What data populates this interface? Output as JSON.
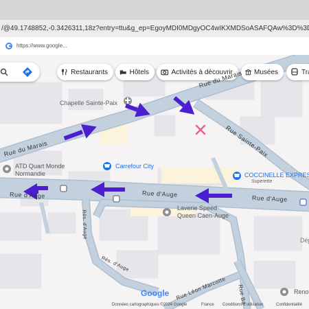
{
  "browser": {
    "url": "/@49.1748852,-0.3426311,18z?entry=ttu&g_ep=EgoyMDI0MDgyOC4wIKXMDSoASAFQAw%3D%3D",
    "suggestion": "https://www.google..."
  },
  "chips": [
    {
      "label": "Restaurants",
      "icon": "fork-knife-icon"
    },
    {
      "label": "Hôtels",
      "icon": "bed-icon"
    },
    {
      "label": "Activités à découvrir",
      "icon": "camera-icon"
    },
    {
      "label": "Musées",
      "icon": "museum-icon"
    },
    {
      "label": "Tra",
      "icon": "transit-icon"
    }
  ],
  "places": {
    "chapelle": "Chapelle Sainte-Paix",
    "atd_line1": "ATD Quart Monde",
    "atd_line2": "Normandie",
    "carrefour": "Carrefour City",
    "coccinelle": "COCCINELLE EXPRESS",
    "coccinelle_sub": "Superette",
    "laverie_line1": "Laverie Speed",
    "laverie_line2": "Queen Caen-Auge",
    "dep": "Dép",
    "reno": "Reno"
  },
  "streets": {
    "marais_top": "Rue du Marais",
    "marais_left": "Rue du Marais",
    "sainte_paix": "Rue Sainte-Paix",
    "auge_left": "Rue d'Auge",
    "auge_center": "Rue d'Auge",
    "auge_right": "Rue d'Auge",
    "rue_d_auge_vertical": "Rés. d'Auge",
    "res_auge_diag": "Rés. d'Auge",
    "leon_marcotte": "Rue Léon Marcotte",
    "rue_ba": "Rue Ba"
  },
  "footer": {
    "logo": "Google",
    "copyright": "Données cartographiques ©2024 Google",
    "country": "France",
    "terms": "Conditions d'utilisation",
    "privacy": "Confidentialité"
  },
  "colors": {
    "road": "#c1cfdd",
    "road_border": "#aebfd0",
    "building": "#e8e8ec",
    "arrow": "#4b1ecf",
    "marker_x": "#e6668a"
  }
}
